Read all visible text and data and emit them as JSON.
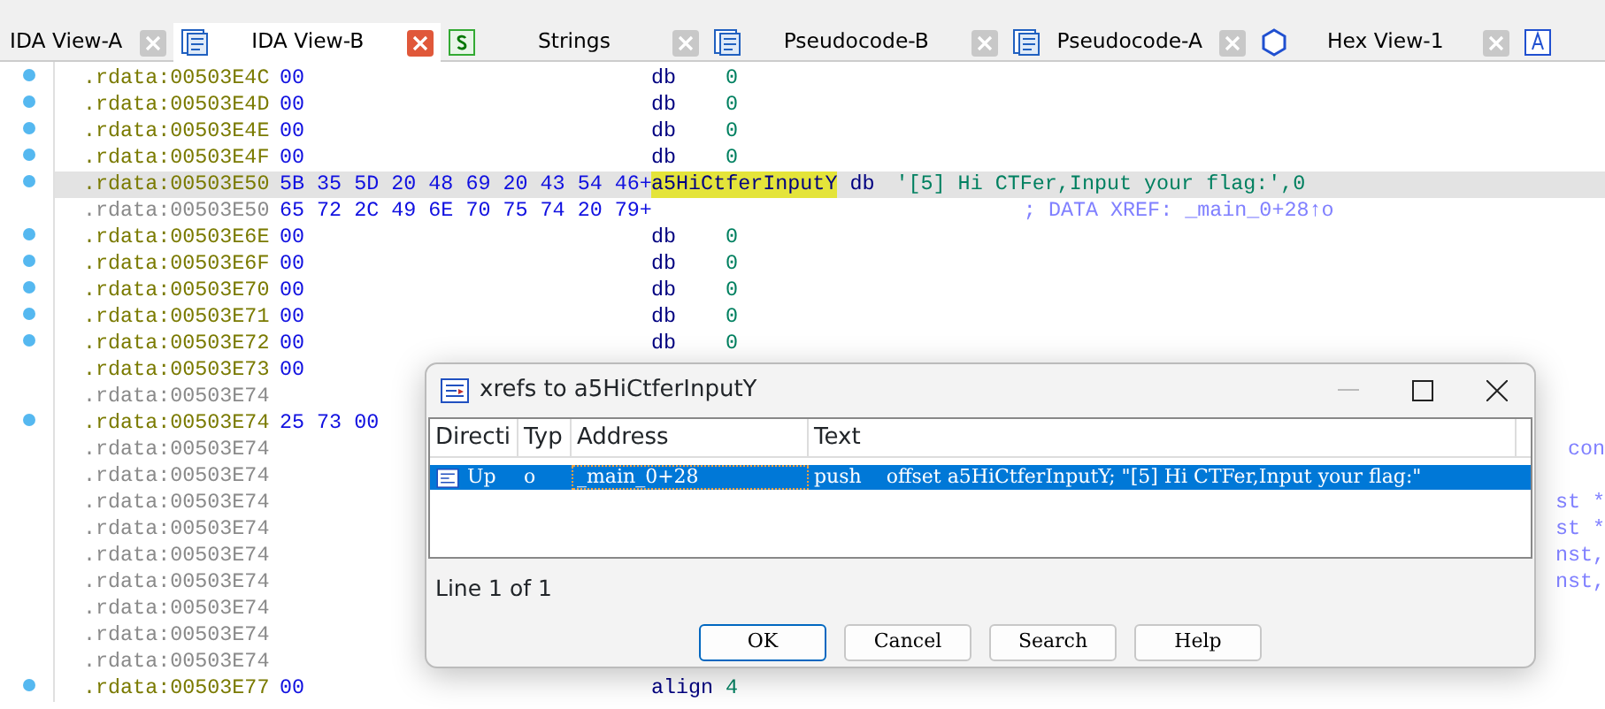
{
  "tabs": [
    {
      "label": "IDA View-A",
      "kind": "plain",
      "selected": false
    },
    {
      "label": "IDA View-B",
      "kind": "listing",
      "selected": true
    },
    {
      "label": "Strings",
      "kind": "strings",
      "selected": false
    },
    {
      "label": "Pseudocode-B",
      "kind": "listing",
      "selected": false
    },
    {
      "label": "Pseudocode-A",
      "kind": "listing",
      "selected": false
    },
    {
      "label": "Hex View-1",
      "kind": "hex",
      "selected": false
    },
    {
      "kind": "struct",
      "selected": false
    }
  ],
  "listing": [
    {
      "address": ".rdata:00503E4C",
      "dim": false,
      "dot": true,
      "selected": false,
      "bytes": "00",
      "mnemonic": "db",
      "operand": "0"
    },
    {
      "address": ".rdata:00503E4D",
      "dim": false,
      "dot": true,
      "selected": false,
      "bytes": "00",
      "mnemonic": "db",
      "operand": "0"
    },
    {
      "address": ".rdata:00503E4E",
      "dim": false,
      "dot": true,
      "selected": false,
      "bytes": "00",
      "mnemonic": "db",
      "operand": "0"
    },
    {
      "address": ".rdata:00503E4F",
      "dim": false,
      "dot": true,
      "selected": false,
      "bytes": "00",
      "mnemonic": "db",
      "operand": "0"
    },
    {
      "address": ".rdata:00503E50",
      "dim": false,
      "dot": true,
      "selected": true,
      "bytes": "5B 35 5D 20 48 69 20 43 54 46+",
      "label": "a5HiCtferInputY",
      "mnemonic": "db",
      "operand": "'[5] Hi CTFer,Input your flag:',0"
    },
    {
      "address": ".rdata:00503E50",
      "dim": true,
      "dot": false,
      "selected": false,
      "bytes": "65 72 2C 49 6E 70 75 74 20 79+",
      "comment": "; DATA XREF: _main_0+28↑o"
    },
    {
      "address": ".rdata:00503E6E",
      "dim": false,
      "dot": true,
      "selected": false,
      "bytes": "00",
      "mnemonic": "db",
      "operand": "0"
    },
    {
      "address": ".rdata:00503E6F",
      "dim": false,
      "dot": true,
      "selected": false,
      "bytes": "00",
      "mnemonic": "db",
      "operand": "0"
    },
    {
      "address": ".rdata:00503E70",
      "dim": false,
      "dot": true,
      "selected": false,
      "bytes": "00",
      "mnemonic": "db",
      "operand": "0"
    },
    {
      "address": ".rdata:00503E71",
      "dim": false,
      "dot": true,
      "selected": false,
      "bytes": "00",
      "mnemonic": "db",
      "operand": "0"
    },
    {
      "address": ".rdata:00503E72",
      "dim": false,
      "dot": true,
      "selected": false,
      "bytes": "00",
      "mnemonic": "db",
      "operand": "0"
    },
    {
      "address": ".rdata:00503E73",
      "dim": false,
      "dot": false,
      "selected": false,
      "bytes": "00"
    },
    {
      "address": ".rdata:00503E74",
      "dim": true,
      "dot": false,
      "selected": false
    },
    {
      "address": ".rdata:00503E74",
      "dim": false,
      "dot": true,
      "selected": false,
      "bytes": "25 73 00"
    },
    {
      "address": ".rdata:00503E74",
      "dim": true,
      "dot": false,
      "selected": false,
      "fragment": "con"
    },
    {
      "address": ".rdata:00503E74",
      "dim": true,
      "dot": false,
      "selected": false
    },
    {
      "address": ".rdata:00503E74",
      "dim": true,
      "dot": false,
      "selected": false,
      "fragment": "st *"
    },
    {
      "address": ".rdata:00503E74",
      "dim": true,
      "dot": false,
      "selected": false,
      "fragment": "st *"
    },
    {
      "address": ".rdata:00503E74",
      "dim": true,
      "dot": false,
      "selected": false,
      "fragment": "nst,"
    },
    {
      "address": ".rdata:00503E74",
      "dim": true,
      "dot": false,
      "selected": false,
      "fragment": "nst,"
    },
    {
      "address": ".rdata:00503E74",
      "dim": true,
      "dot": false,
      "selected": false
    },
    {
      "address": ".rdata:00503E74",
      "dim": true,
      "dot": false,
      "selected": false
    },
    {
      "address": ".rdata:00503E74",
      "dim": true,
      "dot": false,
      "selected": false
    },
    {
      "address": ".rdata:00503E77",
      "dim": false,
      "dot": true,
      "selected": false,
      "bytes": "00",
      "mnemonic": "align",
      "operand": "4"
    }
  ],
  "dialog": {
    "title": "xrefs to a5HiCtferInputY",
    "columns": [
      "Directi",
      "Typ",
      "Address",
      "Text"
    ],
    "rows": [
      {
        "direction": "Up",
        "type": "o",
        "address": "_main_0+28",
        "text": "push    offset a5HiCtferInputY; \"[5] Hi CTFer,Input your flag:\"",
        "selected": true
      }
    ],
    "status": "Line 1 of 1",
    "buttons": [
      {
        "label": "OK",
        "default": true
      },
      {
        "label": "Cancel",
        "default": false
      },
      {
        "label": "Search",
        "default": false
      },
      {
        "label": "Help",
        "default": false
      }
    ]
  }
}
